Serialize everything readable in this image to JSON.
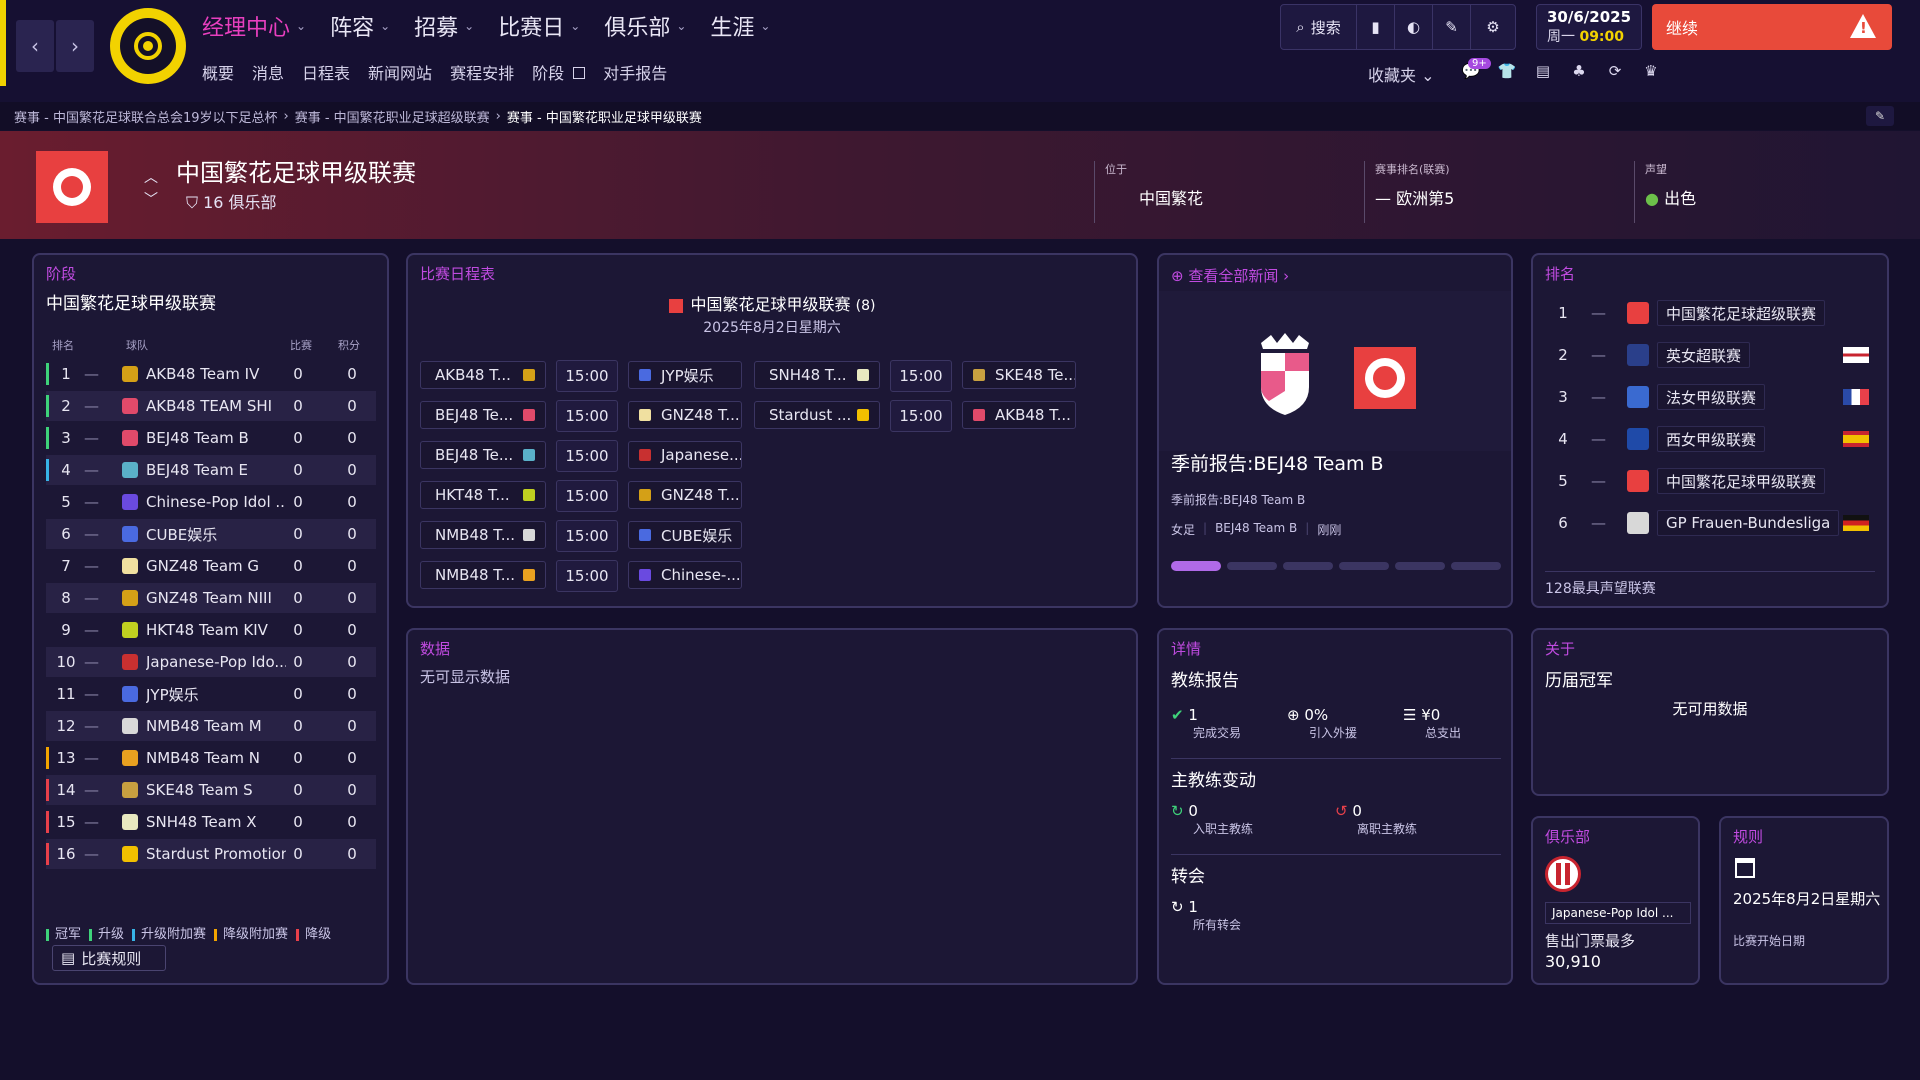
{
  "nav": {
    "menu": [
      "经理中心",
      "阵容",
      "招募",
      "比赛日",
      "俱乐部",
      "生涯"
    ],
    "submenu": [
      "概要",
      "消息",
      "日程表",
      "新闻网站",
      "赛程安排",
      "阶段",
      "对手报告"
    ],
    "search": "搜索",
    "date": "30/6/2025",
    "weekday": "周一",
    "time": "09:00",
    "continue": "继续",
    "favorites": "收藏夹",
    "notif_badge": "9+"
  },
  "breadcrumb": [
    "赛事 - 中国繁花足球联合总会19岁以下足总杯",
    "赛事 - 中国繁花职业足球超级联赛",
    "赛事 - 中国繁花职业足球甲级联赛"
  ],
  "header": {
    "title": "中国繁花足球甲级联赛",
    "clubs": "16 俱乐部",
    "location_label": "位于",
    "location": "中国繁花",
    "rank_label": "赛事排名(联赛)",
    "rank": "欧洲第5",
    "rep_label": "声望",
    "rep": "出色"
  },
  "stage": {
    "title": "阶段",
    "league": "中国繁花足球甲级联赛",
    "cols": [
      "排名",
      "球队",
      "比赛",
      "积分"
    ],
    "rows": [
      {
        "pos": "1",
        "team": "AKB48 Team IV",
        "p": "0",
        "pts": "0"
      },
      {
        "pos": "2",
        "team": "AKB48 TEAM SHI",
        "p": "0",
        "pts": "0"
      },
      {
        "pos": "3",
        "team": "BEJ48 Team B",
        "p": "0",
        "pts": "0"
      },
      {
        "pos": "4",
        "team": "BEJ48 Team E",
        "p": "0",
        "pts": "0"
      },
      {
        "pos": "5",
        "team": "Chinese-Pop Idol ...",
        "p": "0",
        "pts": "0"
      },
      {
        "pos": "6",
        "team": "CUBE娱乐",
        "p": "0",
        "pts": "0"
      },
      {
        "pos": "7",
        "team": "GNZ48 Team G",
        "p": "0",
        "pts": "0"
      },
      {
        "pos": "8",
        "team": "GNZ48 Team NIII",
        "p": "0",
        "pts": "0"
      },
      {
        "pos": "9",
        "team": "HKT48 Team KIV",
        "p": "0",
        "pts": "0"
      },
      {
        "pos": "10",
        "team": "Japanese-Pop Ido...",
        "p": "0",
        "pts": "0"
      },
      {
        "pos": "11",
        "team": "JYP娱乐",
        "p": "0",
        "pts": "0"
      },
      {
        "pos": "12",
        "team": "NMB48 Team M",
        "p": "0",
        "pts": "0"
      },
      {
        "pos": "13",
        "team": "NMB48 Team N",
        "p": "0",
        "pts": "0"
      },
      {
        "pos": "14",
        "team": "SKE48 Team S",
        "p": "0",
        "pts": "0"
      },
      {
        "pos": "15",
        "team": "SNH48 Team X",
        "p": "0",
        "pts": "0"
      },
      {
        "pos": "16",
        "team": "Stardust Promotion",
        "p": "0",
        "pts": "0"
      }
    ],
    "legend": [
      "冠军",
      "升级",
      "升级附加赛",
      "降级附加赛",
      "降级"
    ],
    "rules_button": "比赛规则"
  },
  "fixtures": {
    "title": "比赛日程表",
    "league": "中国繁花足球甲级联赛",
    "count": "(8)",
    "date": "2025年8月2日星期六",
    "left": [
      {
        "home": "AKB48 T...",
        "time": "15:00",
        "away": "JYP娱乐"
      },
      {
        "home": "BEJ48 Te...",
        "time": "15:00",
        "away": "GNZ48 T..."
      },
      {
        "home": "BEJ48 Te...",
        "time": "15:00",
        "away": "Japanese..."
      },
      {
        "home": "HKT48 T...",
        "time": "15:00",
        "away": "GNZ48 T..."
      },
      {
        "home": "NMB48 T...",
        "time": "15:00",
        "away": "CUBE娱乐"
      },
      {
        "home": "NMB48 T...",
        "time": "15:00",
        "away": "Chinese-..."
      }
    ],
    "right": [
      {
        "home": "SNH48 T...",
        "time": "15:00",
        "away": "SKE48 Te..."
      },
      {
        "home": "Stardust ...",
        "time": "15:00",
        "away": "AKB48 T..."
      }
    ]
  },
  "news": {
    "link": "查看全部新闻",
    "headline": "季前报告:BEJ48 Team B",
    "subline": "季前报告:BEJ48 Team B",
    "tags": [
      "女足",
      "BEJ48 Team B",
      "刚刚"
    ]
  },
  "ranking": {
    "title": "排名",
    "rows": [
      {
        "n": "1",
        "name": "中国繁花足球超级联赛",
        "color": "#e84040"
      },
      {
        "n": "2",
        "name": "英女超联赛",
        "color": "#2a3f8a"
      },
      {
        "n": "3",
        "name": "法女甲级联赛",
        "color": "#3a6ad0"
      },
      {
        "n": "4",
        "name": "西女甲级联赛",
        "color": "#1f4aa8"
      },
      {
        "n": "5",
        "name": "中国繁花足球甲级联赛",
        "color": "#e84040"
      },
      {
        "n": "6",
        "name": "GP Frauen-Bundesliga",
        "color": "#d8d8d8"
      }
    ],
    "footer": "128最具声望联赛"
  },
  "data_panel": {
    "title": "数据",
    "empty": "无可显示数据"
  },
  "details": {
    "title": "详情",
    "coach_report": "教练报告",
    "trades_val": "1",
    "trades_lab": "完成交易",
    "aid_val": "0%",
    "aid_lab": "引入外援",
    "spend_val": "¥0",
    "spend_lab": "总支出",
    "coach_change": "主教练变动",
    "in_val": "0",
    "in_lab": "入职主教练",
    "out_val": "0",
    "out_lab": "离职主教练",
    "transfer": "转会",
    "all_val": "1",
    "all_lab": "所有转会"
  },
  "about": {
    "title": "关于",
    "champions": "历届冠军",
    "empty": "无可用数据"
  },
  "club": {
    "title": "俱乐部",
    "name": "Japanese-Pop Idol ...",
    "label": "售出门票最多",
    "value": "30,910"
  },
  "rules": {
    "title": "规则",
    "date": "2025年8月2日星期六",
    "label": "比赛开始日期"
  }
}
